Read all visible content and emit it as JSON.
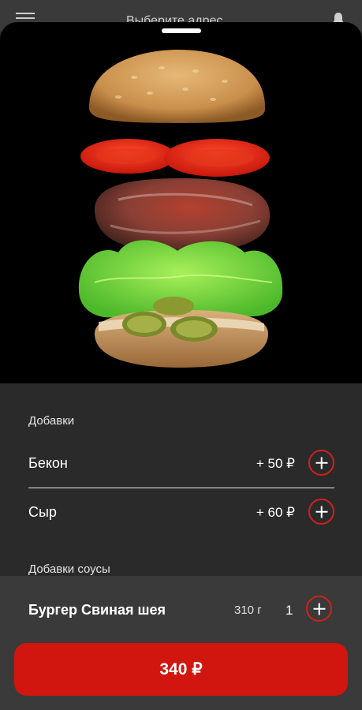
{
  "behind": {
    "title": "Выберите адрес"
  },
  "addons": {
    "section_title": "Добавки",
    "items": [
      {
        "name": "Бекон",
        "price": "+ 50 ₽"
      },
      {
        "name": "Сыр",
        "price": "+ 60 ₽"
      }
    ]
  },
  "sauces": {
    "section_title": "Добавки соусы"
  },
  "product": {
    "name": "Бургер Свиная шея",
    "weight": "310 г",
    "quantity": "1"
  },
  "checkout": {
    "total_label": "340 ₽"
  },
  "colors": {
    "accent": "#d0160f",
    "sheet_background": "#2a2a2a",
    "bottom_bar": "#3a3a3a"
  }
}
